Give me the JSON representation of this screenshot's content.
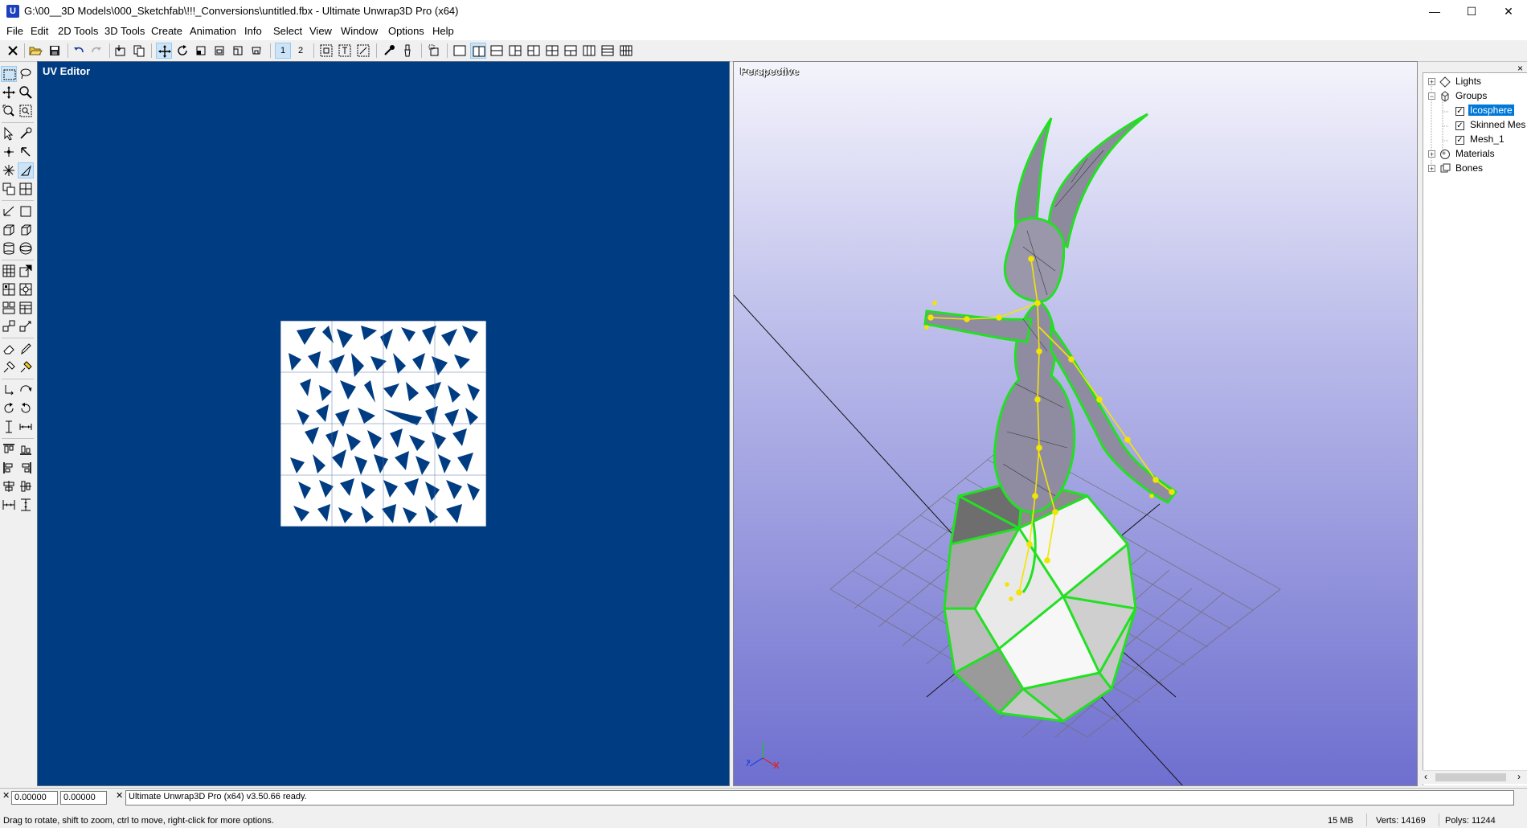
{
  "window": {
    "title": "G:\\00__3D Models\\000_Sketchfab\\!!!_Conversions\\untitled.fbx - Ultimate Unwrap3D Pro (x64)",
    "app_icon_letter": "U",
    "minimize": "—",
    "maximize": "☐",
    "close": "✕"
  },
  "menu": [
    "File",
    "Edit",
    "2D Tools",
    "3D Tools",
    "Create",
    "Animation",
    "Info",
    "Select",
    "View",
    "Window",
    "Options",
    "Help"
  ],
  "toolbar": {
    "mode_1": "1",
    "mode_2": "2"
  },
  "uv_editor": {
    "title": "UV Editor"
  },
  "perspective": {
    "title": "Perspective",
    "colors": {
      "wire": "#1fd31f",
      "bones": "#f2e500",
      "grid": "#6e6e6e"
    }
  },
  "scene_tree": {
    "close": "×",
    "lights": "Lights",
    "groups": "Groups",
    "group_items": [
      "Icosphere",
      "Skinned Mes",
      "Mesh_1"
    ],
    "materials": "Materials",
    "bones": "Bones",
    "expand_plus": "+",
    "expand_minus": "−",
    "check": "✓",
    "scroll_left": "‹",
    "scroll_right": "›"
  },
  "coords": {
    "u": "0.00000",
    "v": "0.00000"
  },
  "console": {
    "close": "✕",
    "text": "Ultimate Unwrap3D Pro (x64) v3.50.66 ready."
  },
  "status": {
    "hint": "Drag to rotate, shift to zoom, ctrl to move, right-click for more options.",
    "memory": "15 MB",
    "verts": "Verts: 14169",
    "polys": "Polys: 11244"
  }
}
